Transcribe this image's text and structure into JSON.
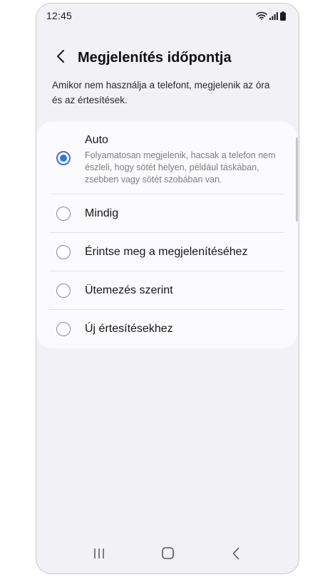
{
  "status": {
    "time": "12:45"
  },
  "header": {
    "title": "Megjelenítés időpontja"
  },
  "description": "Amikor nem használja a telefont, megjelenik az óra és az értesítések.",
  "options": [
    {
      "label": "Auto",
      "description": "Folyamatosan megjelenik, hacsak a telefon nem észleli, hogy sötét helyen, például táskában, zsebben vagy sötét szobában van.",
      "selected": true
    },
    {
      "label": "Mindig",
      "selected": false
    },
    {
      "label": "Érintse meg a megjelenítéséhez",
      "selected": false
    },
    {
      "label": "Ütemezés szerint",
      "selected": false
    },
    {
      "label": "Új értesítésekhez",
      "selected": false
    }
  ],
  "colors": {
    "accent": "#3a6fe0",
    "background": "#f2f2f6",
    "card": "#fbfbfe"
  },
  "icons": {
    "back": "back-arrow-icon",
    "wifi": "wifi-icon",
    "signal": "signal-icon",
    "battery": "battery-icon",
    "recents": "recents-icon",
    "home": "home-icon",
    "nav_back": "nav-back-icon"
  }
}
